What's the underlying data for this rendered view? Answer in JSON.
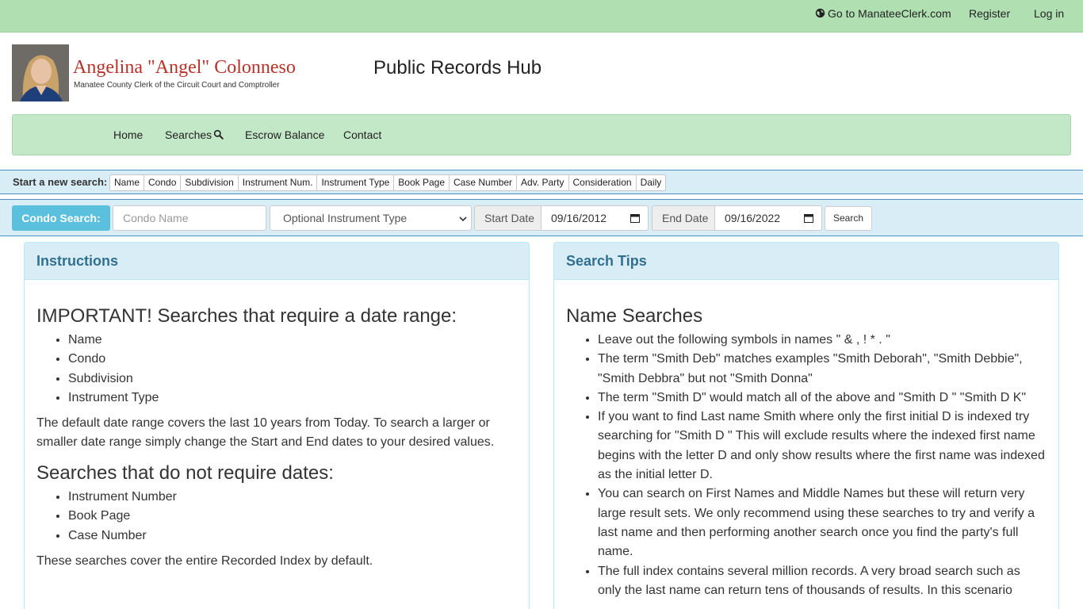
{
  "topbar": {
    "manatee_link": "Go to ManateeClerk.com",
    "register": "Register",
    "login": "Log in"
  },
  "header": {
    "clerk_name": "Angelina \"Angel\" Colonneso",
    "clerk_subtitle": "Manatee County Clerk of the Circuit Court and Comptroller",
    "site_title": "Public Records Hub"
  },
  "nav": {
    "home": "Home",
    "searches": "Searches",
    "escrow": "Escrow Balance",
    "contact": "Contact"
  },
  "quick_search": {
    "label": "Start a new search:",
    "options": [
      "Name",
      "Condo",
      "Subdivision",
      "Instrument Num.",
      "Instrument Type",
      "Book Page",
      "Case Number",
      "Adv. Party",
      "Consideration",
      "Daily"
    ]
  },
  "condo_search": {
    "label": "Condo Search:",
    "name_placeholder": "Condo Name",
    "instrument_type_selected": "Optional Instrument Type",
    "start_label": "Start Date",
    "start_value": "09/16/2012",
    "end_label": "End Date",
    "end_value": "09/16/2022",
    "search_button": "Search"
  },
  "instructions": {
    "title": "Instructions",
    "heading1": "IMPORTANT! Searches that require a date range:",
    "list1": [
      "Name",
      "Condo",
      "Subdivision",
      "Instrument Type"
    ],
    "para1": "The default date range covers the last 10 years from Today. To search a larger or smaller date range simply change the Start and End dates to your desired values.",
    "heading2": "Searches that do not require dates:",
    "list2": [
      "Instrument Number",
      "Book Page",
      "Case Number"
    ],
    "para2": "These searches cover the entire Recorded Index by default."
  },
  "search_tips": {
    "title": "Search Tips",
    "heading": "Name Searches",
    "tips": [
      "Leave out the following symbols in names \" & , ! * . \"",
      "The term \"Smith Deb\" matches examples \"Smith Deborah\", \"Smith Debbie\", \"Smith Debbra\" but not \"Smith Donna\"",
      "The term \"Smith D\" would match all of the above and \"Smith D \" \"Smith D K\"",
      "If you want to find Last name Smith where only the first initial D is indexed try searching for \"Smith D \" This will exclude results where the indexed first name begins with the letter D and only show results where the first name was indexed as the initial letter D.",
      "You can search on First Names and Middle Names but these will return very large result sets. We only recommend using these searches to try and verify a last name and then performing another search once you find the party's full name.",
      "The full index contains several million records. A very broad search such as only the last name can return tens of thousands of results. In this scenario"
    ]
  }
}
